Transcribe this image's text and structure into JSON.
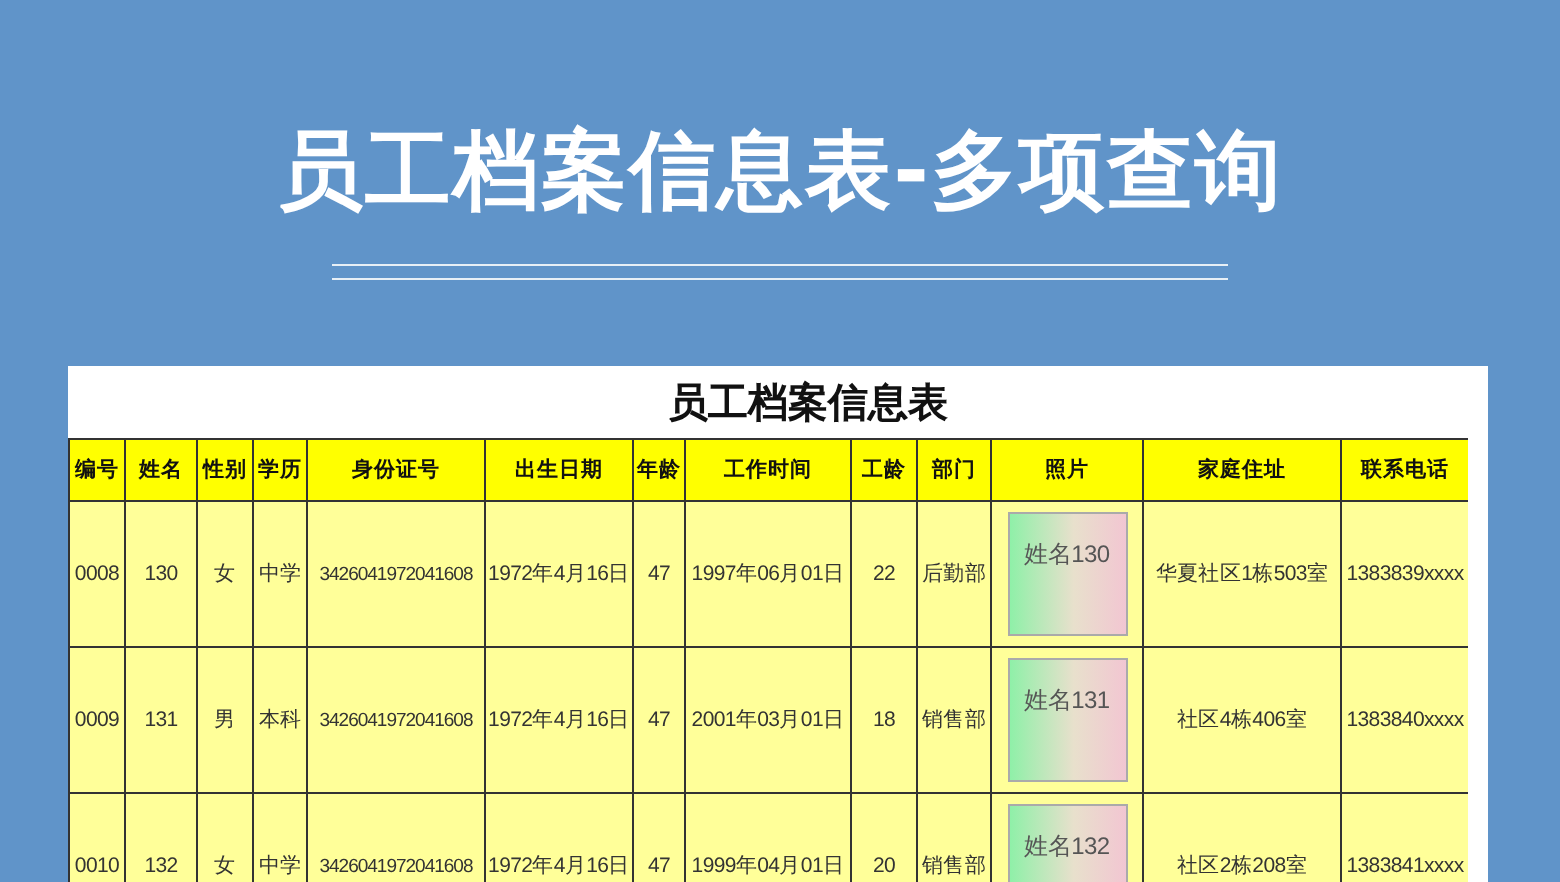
{
  "banner": {
    "title": "员工档案信息表-多项查询"
  },
  "sheet": {
    "title": "员工档案信息表",
    "columns": [
      "编号",
      "姓名",
      "性别",
      "学历",
      "身份证号",
      "出生日期",
      "年龄",
      "工作时间",
      "工龄",
      "部门",
      "照片",
      "家庭住址",
      "联系电话"
    ],
    "rows": [
      {
        "cells": [
          "0008",
          "130",
          "女",
          "中学",
          "3426041972041608",
          "1972年4月16日",
          "47",
          "1997年06月01日",
          "22",
          "后勤部",
          "姓名130",
          "华夏社区1栋503室",
          "1383839xxxx"
        ]
      },
      {
        "cells": [
          "0009",
          "131",
          "男",
          "本科",
          "3426041972041608",
          "1972年4月16日",
          "47",
          "2001年03月01日",
          "18",
          "销售部",
          "姓名131",
          "社区4栋406室",
          "1383840xxxx"
        ]
      },
      {
        "cells": [
          "0010",
          "132",
          "女",
          "中学",
          "3426041972041608",
          "1972年4月16日",
          "47",
          "1999年04月01日",
          "20",
          "销售部",
          "姓名132",
          "社区2栋208室",
          "1383841xxxx"
        ]
      }
    ]
  }
}
